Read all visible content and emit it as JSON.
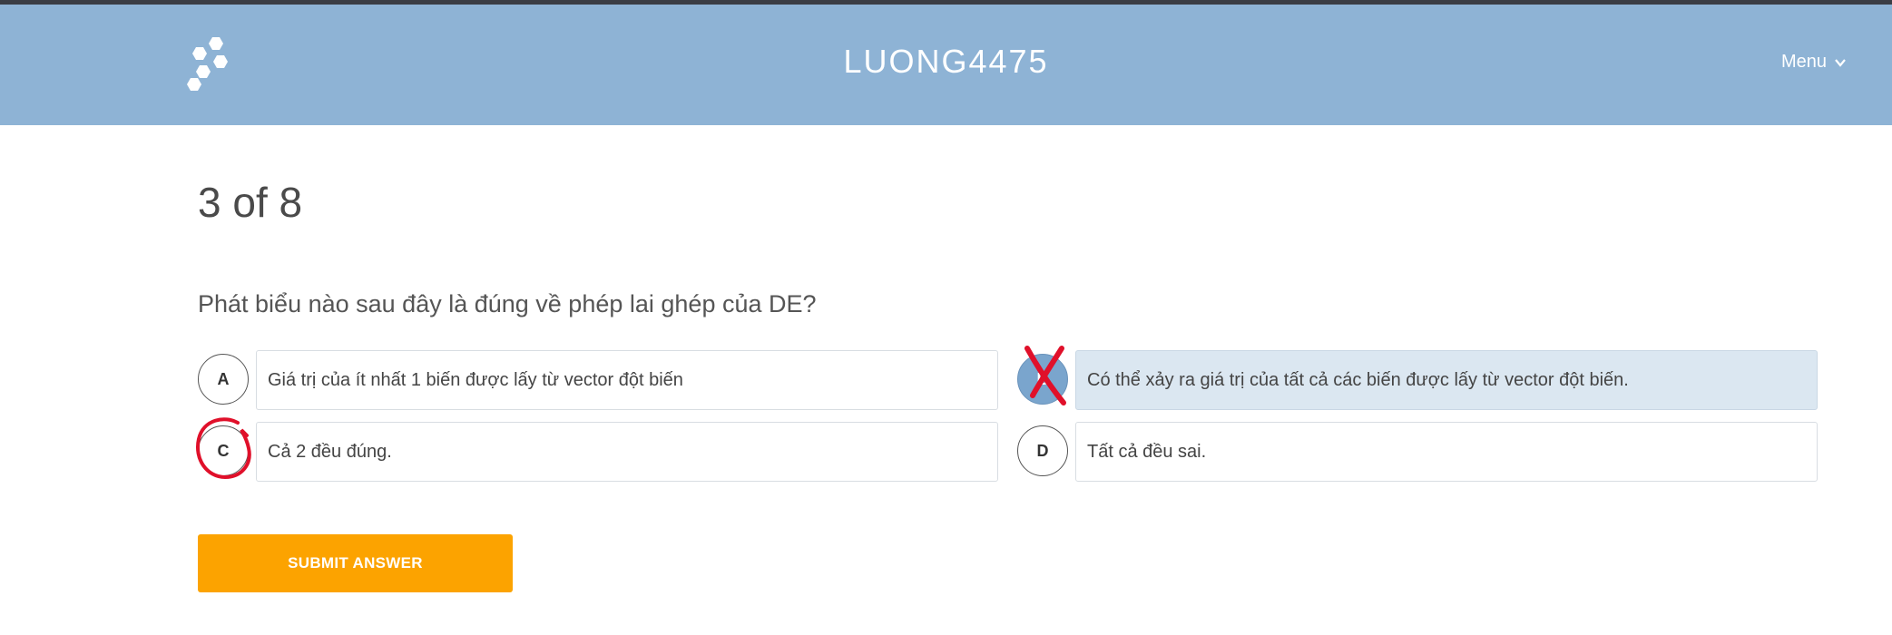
{
  "header": {
    "title": "LUONG4475",
    "menu_label": "Menu"
  },
  "quiz": {
    "progress": "3 of 8",
    "question": "Phát biểu nào sau đây là đúng về phép lai ghép của DE?",
    "options": [
      {
        "letter": "A",
        "text": "Giá trị của ít nhất 1 biến được lấy từ vector đột biến",
        "selected": false
      },
      {
        "letter": "B",
        "text": "Có thể xảy ra giá trị của tất cả các biến được lấy từ vector đột biến.",
        "selected": true
      },
      {
        "letter": "C",
        "text": "Cả 2 đều đúng.",
        "selected": false
      },
      {
        "letter": "D",
        "text": "Tất cả đều sai.",
        "selected": false
      }
    ],
    "submit_label": "SUBMIT ANSWER"
  },
  "annotations": {
    "cross_mark_option": "B",
    "circle_mark_option": "C",
    "color": "#e0102a"
  },
  "colors": {
    "header_bg": "#8eb3d5",
    "selected_bg": "#dbe7f1",
    "submit_bg": "#fca300"
  }
}
